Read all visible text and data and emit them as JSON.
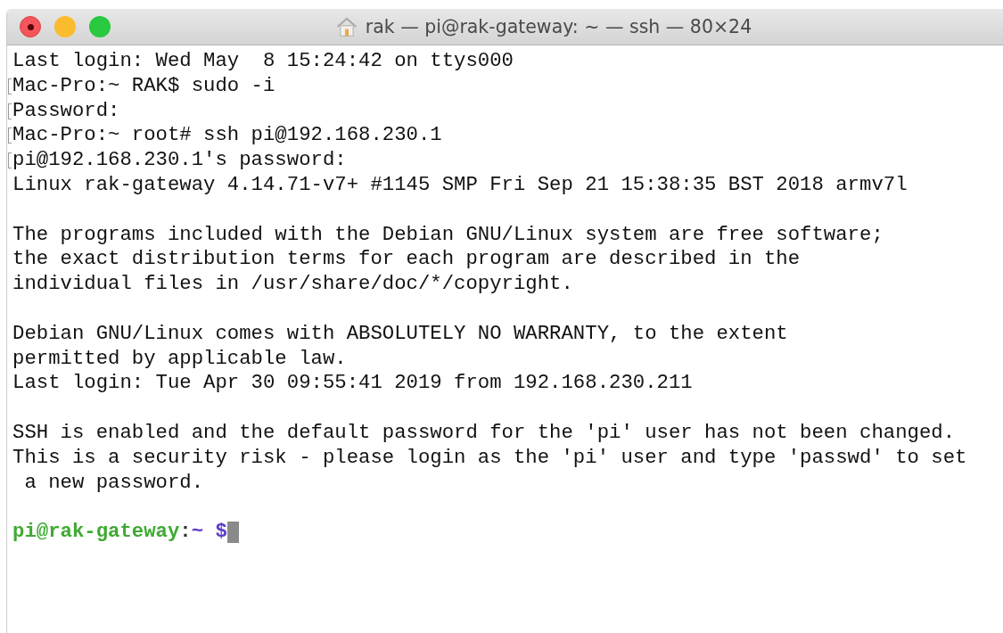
{
  "window": {
    "title": "rak — pi@rak-gateway: ~ — ssh — 80×24"
  },
  "lines": [
    {
      "kind": "text",
      "text": "Last login: Wed May  8 15:24:42 on ttys000",
      "marked": false
    },
    {
      "kind": "text",
      "text": "Mac-Pro:~ RAK$ sudo -i",
      "marked": true
    },
    {
      "kind": "text",
      "text": "Password:",
      "marked": true
    },
    {
      "kind": "text",
      "text": "Mac-Pro:~ root# ssh pi@192.168.230.1",
      "marked": true
    },
    {
      "kind": "text",
      "text": "pi@192.168.230.1's password:",
      "marked": true
    },
    {
      "kind": "text",
      "text": "Linux rak-gateway 4.14.71-v7+ #1145 SMP Fri Sep 21 15:38:35 BST 2018 armv7l",
      "marked": false
    },
    {
      "kind": "blank"
    },
    {
      "kind": "text",
      "text": "The programs included with the Debian GNU/Linux system are free software;",
      "marked": false
    },
    {
      "kind": "text",
      "text": "the exact distribution terms for each program are described in the",
      "marked": false
    },
    {
      "kind": "text",
      "text": "individual files in /usr/share/doc/*/copyright.",
      "marked": false
    },
    {
      "kind": "blank"
    },
    {
      "kind": "text",
      "text": "Debian GNU/Linux comes with ABSOLUTELY NO WARRANTY, to the extent",
      "marked": false
    },
    {
      "kind": "text",
      "text": "permitted by applicable law.",
      "marked": false
    },
    {
      "kind": "text",
      "text": "Last login: Tue Apr 30 09:55:41 2019 from 192.168.230.211",
      "marked": false
    },
    {
      "kind": "blank"
    },
    {
      "kind": "text",
      "text": "SSH is enabled and the default password for the 'pi' user has not been changed.",
      "marked": false
    },
    {
      "kind": "text",
      "text": "This is a security risk - please login as the 'pi' user and type 'passwd' to set",
      "marked": false
    },
    {
      "kind": "text",
      "text": " a new password.",
      "marked": false
    },
    {
      "kind": "blank"
    },
    {
      "kind": "prompt",
      "host": "pi@rak-gateway",
      "sep": ":",
      "path": "~",
      "symbol": "$"
    }
  ]
}
